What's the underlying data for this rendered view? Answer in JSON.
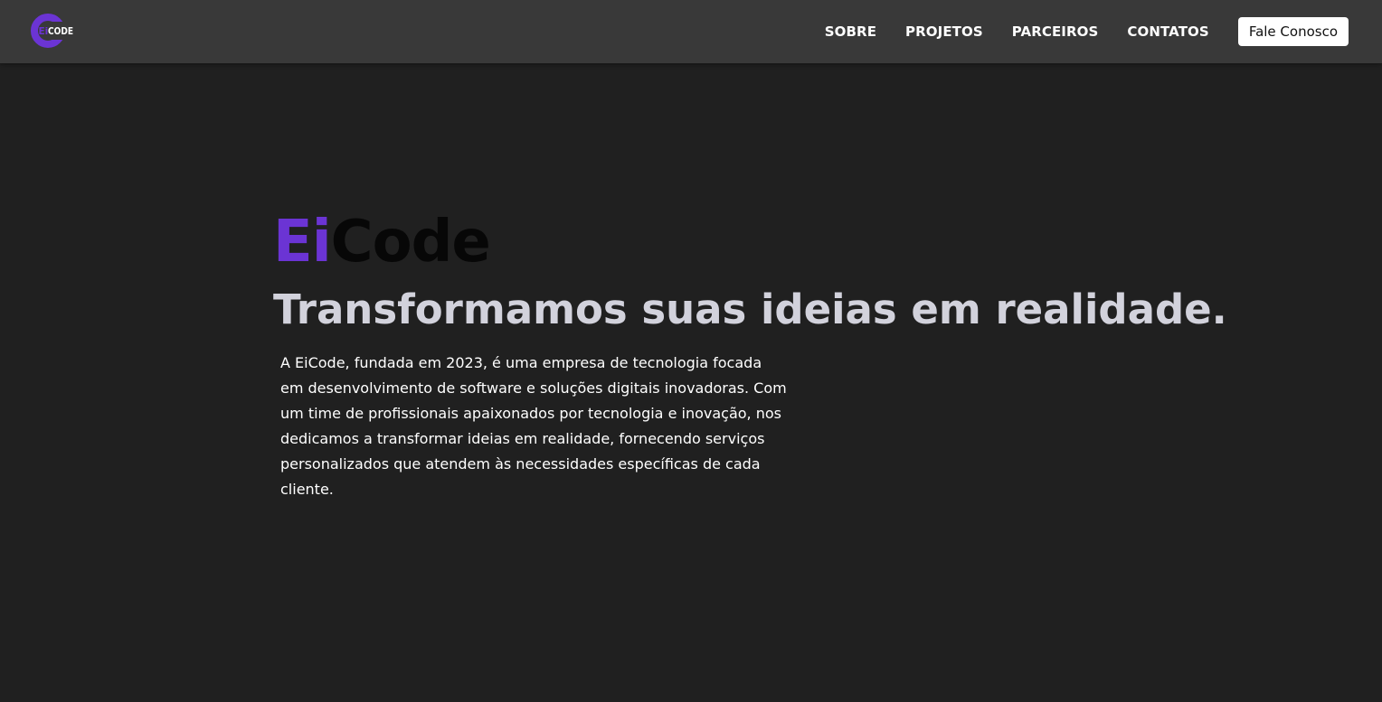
{
  "header": {
    "logo": {
      "text_prefix": "Ei",
      "text_suffix": "CODE",
      "accent_color": "#6b34d4"
    },
    "nav_items": [
      {
        "label": "SOBRE"
      },
      {
        "label": "PROJETOS"
      },
      {
        "label": "PARCEIROS"
      },
      {
        "label": "CONTATOS"
      }
    ],
    "cta_label": "Fale Conosco"
  },
  "hero": {
    "brand_prefix": "Ei",
    "brand_suffix": "Code",
    "tagline": "Transformamos suas ideias em realidade.",
    "description": "A EiCode, fundada em 2023, é uma empresa de tecnologia focada em desenvolvimento de software e soluções digitais inovadoras. Com um time de profissionais apaixonados por tecnologia e inovação, nos dedicamos a transformar ideias em realidade, fornecendo serviços personalizados que atendem às necessidades específicas de cada cliente."
  },
  "colors": {
    "background": "#202020",
    "navbar": "#393939",
    "accent": "#6b34d4",
    "tagline": "#d2d2dc"
  }
}
